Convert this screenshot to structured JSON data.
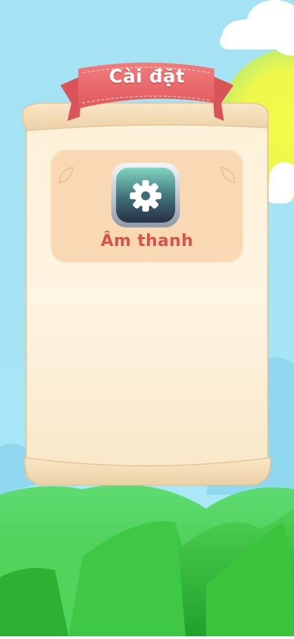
{
  "panel": {
    "title": "Cài đặt"
  },
  "menu": {
    "items": [
      {
        "label": "Âm thanh",
        "icon": "gear-icon"
      }
    ]
  },
  "colors": {
    "sky": "#9fe3f6",
    "ribbon": "#e9686a",
    "parchment": "#fdf2dc",
    "card": "#f7d9b2",
    "label": "#d9524b",
    "button_top": "#7fd2bf",
    "button_bottom": "#2b3447"
  }
}
